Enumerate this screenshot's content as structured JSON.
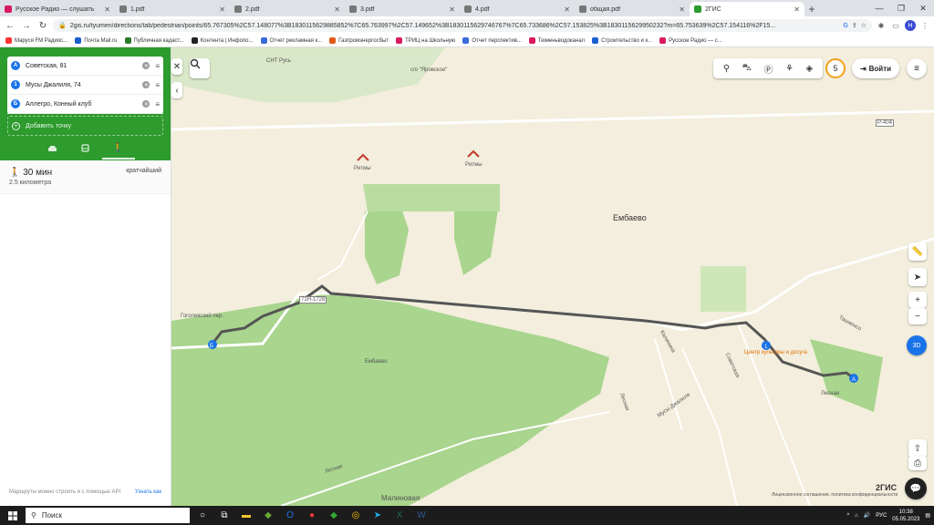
{
  "browser": {
    "tabs": [
      {
        "title": "Русское Радио — слушать",
        "color": "#d81b60",
        "active": false
      },
      {
        "title": "1.pdf",
        "color": "#777777",
        "active": false
      },
      {
        "title": "2.pdf",
        "color": "#777777",
        "active": false
      },
      {
        "title": "3.pdf",
        "color": "#777777",
        "active": false
      },
      {
        "title": "4.pdf",
        "color": "#777777",
        "active": false
      },
      {
        "title": "общая.pdf",
        "color": "#777777",
        "active": false
      },
      {
        "title": "2ГИС",
        "color": "#2d9b2d",
        "active": true
      }
    ],
    "new_tab": "+",
    "url": "2gis.ru/tyumen/directions/tab/pedestrian/points/65.767305%2C57.148077%3B1830115629885852%7C65.763997%2C57.149652%3B1830115629746767%7C65.733686%2C57.153825%3B1830115629950232?m=65.753639%2C57.154116%2F15...",
    "bookmarks": [
      {
        "label": "Маруся FM Радиос...",
        "color": "#ff3333"
      },
      {
        "label": "Почта Mail.ru",
        "color": "#1a5fd0"
      },
      {
        "label": "Публичная кадаст...",
        "color": "#2a7a2a"
      },
      {
        "label": "Контента | Инфопо...",
        "color": "#222222"
      },
      {
        "label": "Отчет рекламная к...",
        "color": "#3b6bd8"
      },
      {
        "label": "Газпромэнергосбыт",
        "color": "#e05a1a"
      },
      {
        "label": "ТРИЦ на Школьную",
        "color": "#d81b60"
      },
      {
        "label": "Отчет перспектив...",
        "color": "#3b6bd8"
      },
      {
        "label": "Тюменьводоканал",
        "color": "#d81b60"
      },
      {
        "label": "Строительство и к...",
        "color": "#1a5fd0"
      },
      {
        "label": "Русское Радио — с...",
        "color": "#d81b60"
      }
    ],
    "profile_initial": "Н"
  },
  "sidebar": {
    "points": [
      {
        "badge": "А",
        "name": "Советская, 81",
        "color": "#1a73e8"
      },
      {
        "badge": "1",
        "name": "Мусы Джалиля, 74",
        "color": "#1a73e8"
      },
      {
        "badge": "Б",
        "name": "Аллегро, Конный клуб",
        "color": "#1a73e8"
      }
    ],
    "add_point": "Добавить точку",
    "result": {
      "duration": "30 мин",
      "distance": "2.5 километра",
      "tag": "кратчайший"
    },
    "api_note": "Маршруты можно строить и с помощью API",
    "api_link": "Узнать как"
  },
  "map": {
    "labels": {
      "embaevo_big": "Ембаево",
      "ritmy1": "Ритмы",
      "ritmy2": "Ритмы",
      "culture": "Центр культуры и досуга",
      "embaevo_small": "Ембаево",
      "lesnaya": "Лесная",
      "lesnaya2": "Лесная",
      "kalinina": "Калинина",
      "sovetskaya": "Советская",
      "musy": "Мусы Джалиля",
      "tashkent": "Ташкенсо",
      "road_code": "71Н-1728",
      "road_p404": "Р-404",
      "snt": "СНТ Русь",
      "snt2": "с/о \"Яровское\"",
      "gogol": "Гоголевский пер.",
      "malinovaya": "Малиновая",
      "lesnaya3": "Лесная",
      "brand": "2ГИС",
      "license": "Лицензионное соглашение, политика конфиденциальности"
    },
    "login": "Войти",
    "tile_count": "5",
    "zoom_in": "+",
    "zoom_out": "−",
    "three_d": "3D"
  },
  "taskbar": {
    "search_placeholder": "Поиск",
    "lang": "РУС",
    "time": "10:38",
    "date": "05.05.2023"
  }
}
